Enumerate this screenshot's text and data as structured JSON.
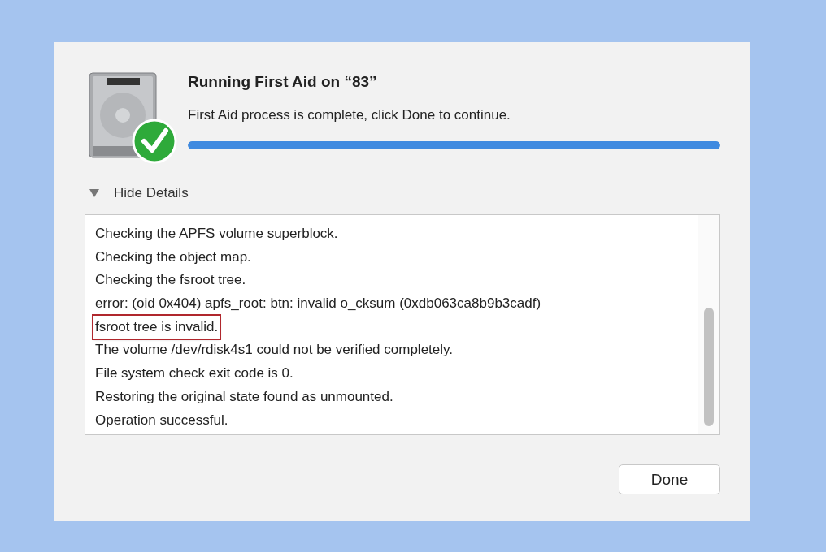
{
  "dialog": {
    "title": "Running First Aid on “83”",
    "message": "First Aid process is complete, click Done to continue.",
    "progress": {
      "level": 1.0
    },
    "details": {
      "label": "Hide Details",
      "expanded": true
    },
    "log": [
      {
        "text": "Checking the APFS volume superblock.",
        "highlighted": false
      },
      {
        "text": "Checking the object map.",
        "highlighted": false
      },
      {
        "text": "Checking the fsroot tree.",
        "highlighted": false
      },
      {
        "text": "error: (oid 0x404) apfs_root: btn: invalid o_cksum (0xdb063ca8b9b3cadf)",
        "highlighted": false
      },
      {
        "text": "fsroot tree is invalid.",
        "highlighted": true
      },
      {
        "text": "The volume /dev/rdisk4s1 could not be verified completely.",
        "highlighted": false
      },
      {
        "text": "File system check exit code is 0.",
        "highlighted": false
      },
      {
        "text": "Restoring the original state found as unmounted.",
        "highlighted": false
      },
      {
        "text": "Operation successful.",
        "highlighted": false
      }
    ],
    "buttons": [
      "Done"
    ]
  }
}
